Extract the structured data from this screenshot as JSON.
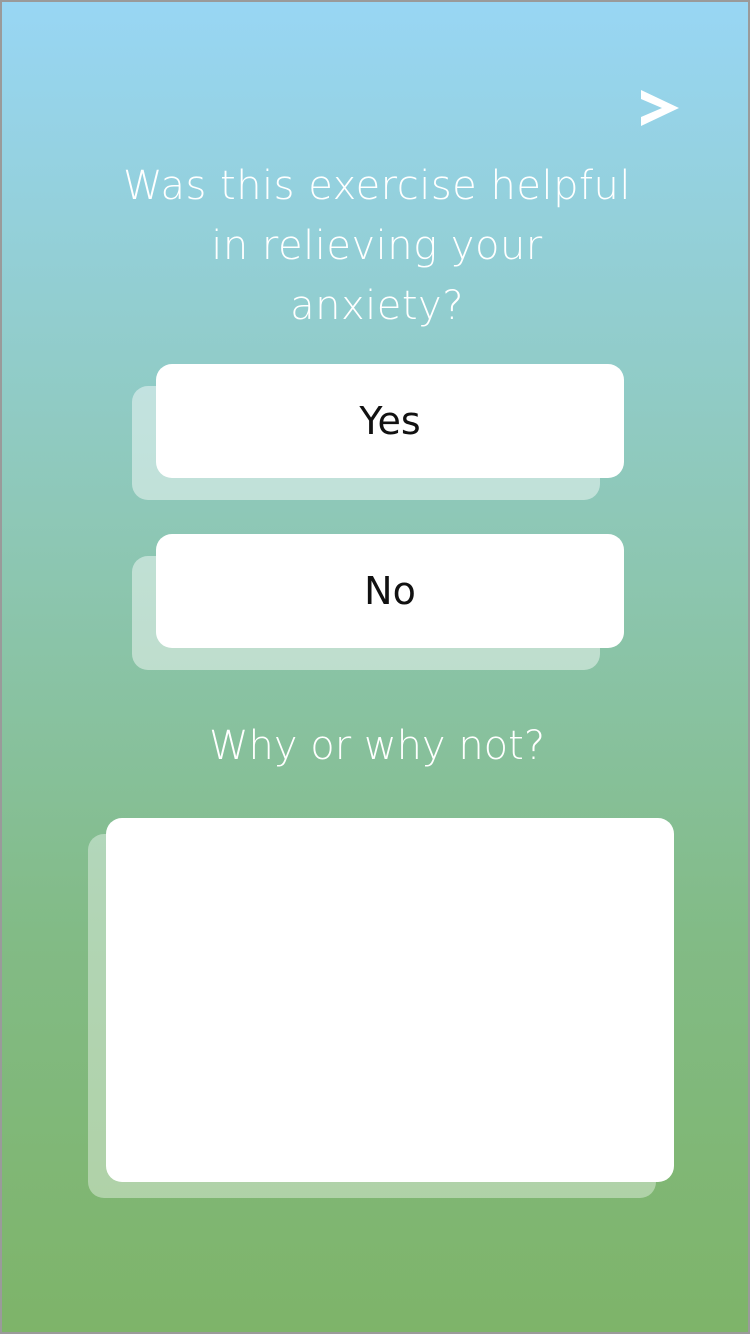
{
  "question": {
    "lines": [
      "Was this exercise helpful",
      "in relieving your",
      "anxiety?"
    ]
  },
  "answers": {
    "yes_label": "Yes",
    "no_label": "No"
  },
  "follow_up": {
    "label": "Why or why not?",
    "input_value": ""
  },
  "icons": {
    "next": "next-arrow-icon"
  },
  "colors": {
    "gradient_top": "#98d6f4",
    "gradient_bottom": "#7eb469",
    "card": "#ffffff",
    "text_light": "#ffffff",
    "text_dark": "#111111"
  }
}
